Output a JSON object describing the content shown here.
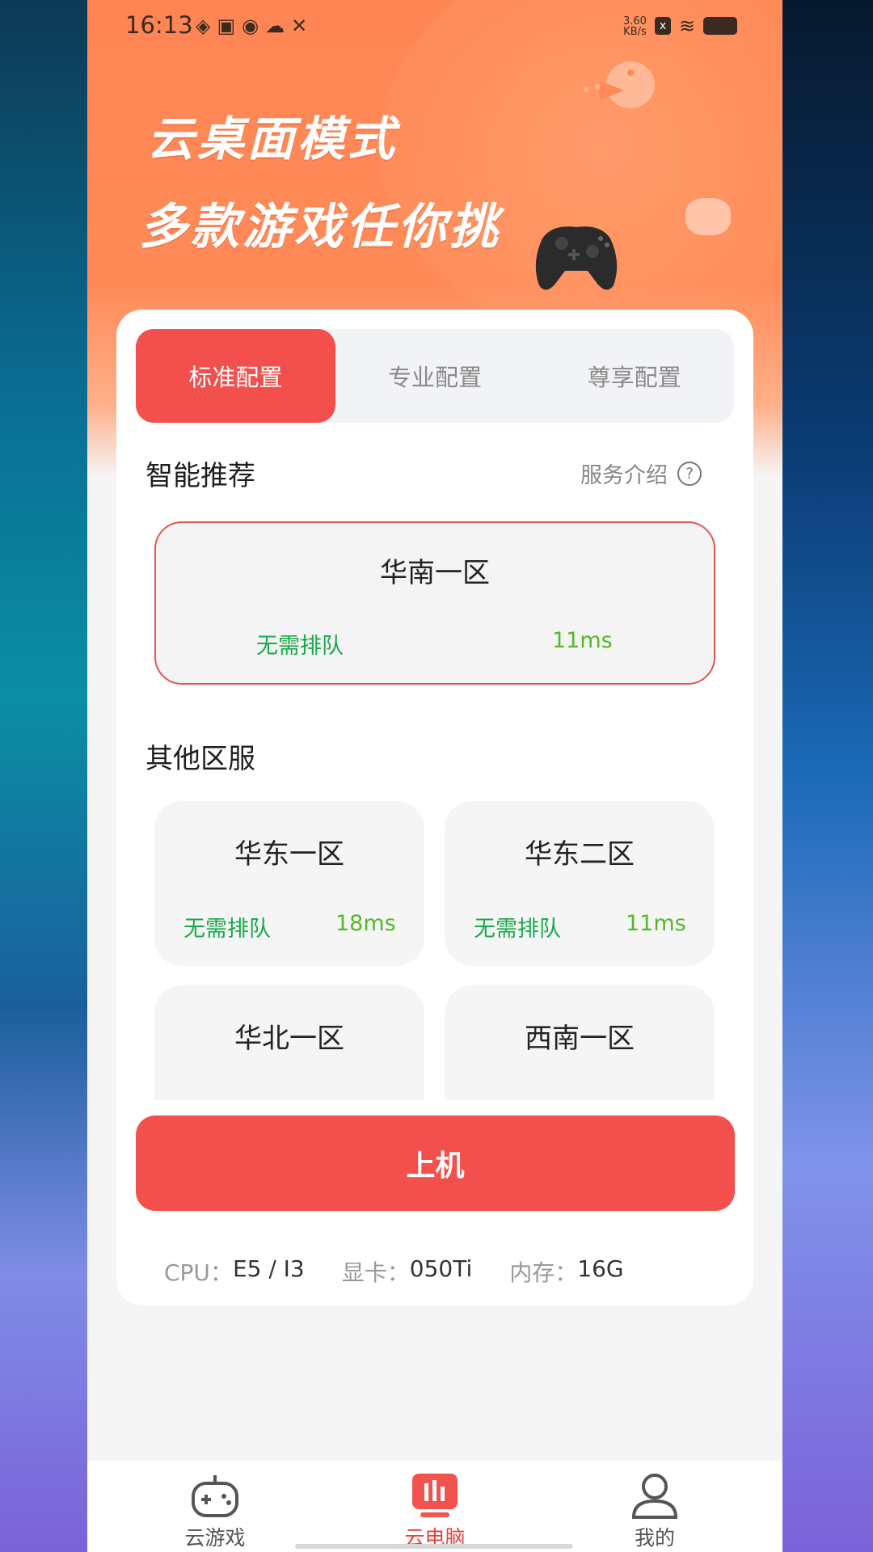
{
  "status_bar": {
    "time": "16:13",
    "net_speed_value": "3.60",
    "net_speed_unit": "KB/s",
    "sim_icon": "x",
    "notification_icons": [
      "app-icon",
      "calendar-icon",
      "cat-icon",
      "cloud-icon",
      "tools-icon"
    ],
    "wifi_icon": "wifi-icon",
    "battery_icon": "battery-icon"
  },
  "hero": {
    "line1": "云桌面模式",
    "line2": "多款游戏任你挑"
  },
  "config_tabs": [
    {
      "label": "标准配置",
      "active": true
    },
    {
      "label": "专业配置",
      "active": false
    },
    {
      "label": "尊享配置",
      "active": false
    }
  ],
  "recommend": {
    "title": "智能推荐",
    "service_intro": "服务介绍",
    "server": {
      "name": "华南一区",
      "queue": "无需排队",
      "ping": "11ms"
    }
  },
  "others": {
    "title": "其他区服",
    "servers": [
      {
        "name": "华东一区",
        "queue": "无需排队",
        "ping": "18ms"
      },
      {
        "name": "华东二区",
        "queue": "无需排队",
        "ping": "11ms"
      },
      {
        "name": "华北一区"
      },
      {
        "name": "西南一区"
      }
    ]
  },
  "go_button": "上机",
  "specs": {
    "cpu_label": "CPU：",
    "cpu_value": "E5 / I3",
    "gpu_label": "显卡：",
    "gpu_value": "050Ti",
    "ram_label": "内存：",
    "ram_value": "16G"
  },
  "nav": [
    {
      "label": "云游戏",
      "icon": "gamepad-icon",
      "active": false
    },
    {
      "label": "云电脑",
      "icon": "cloud-pc-icon",
      "active": true
    },
    {
      "label": "我的",
      "icon": "user-icon",
      "active": false
    }
  ],
  "colors": {
    "accent": "#f34f4c",
    "hero": "#ff8654",
    "queue_green": "#18a94a",
    "ping_green": "#55b82a"
  }
}
